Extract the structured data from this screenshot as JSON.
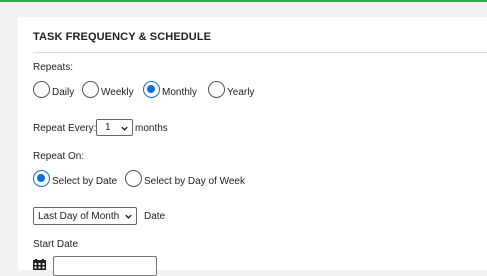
{
  "section_title": "TASK FREQUENCY & SCHEDULE",
  "repeats": {
    "label": "Repeats:",
    "options": [
      "Daily",
      "Weekly",
      "Monthly",
      "Yearly"
    ],
    "selected": "Monthly"
  },
  "repeat_every": {
    "label": "Repeat Every:",
    "value": "1",
    "unit": "months"
  },
  "repeat_on": {
    "label": "Repeat On:",
    "options": [
      "Select by Date",
      "Select by Day of Week"
    ],
    "selected": "Select by Date"
  },
  "date_select": {
    "value": "Last Day of Month",
    "suffix": "Date"
  },
  "start_date": {
    "label": "Start Date",
    "value": ""
  },
  "colors": {
    "accent": "#0b6fe0",
    "top_bar": "#3aa64b"
  },
  "icons": {
    "calendar": "calendar-icon",
    "dropdown": "chevron-down-icon"
  }
}
